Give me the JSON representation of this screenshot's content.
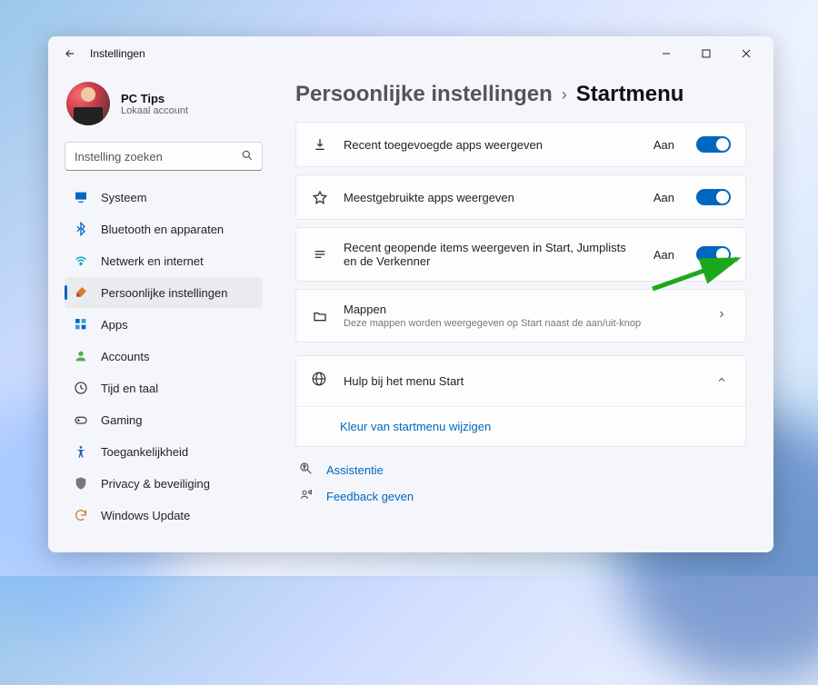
{
  "window": {
    "title": "Instellingen"
  },
  "profile": {
    "name": "PC Tips",
    "account_type": "Lokaal account"
  },
  "search": {
    "placeholder": "Instelling zoeken"
  },
  "sidebar": {
    "items": [
      {
        "icon": "monitor",
        "label": "Systeem",
        "color": "#0067c0"
      },
      {
        "icon": "bluetooth",
        "label": "Bluetooth en apparaten",
        "color": "#0067c0"
      },
      {
        "icon": "wifi",
        "label": "Netwerk en internet",
        "color": "#00a6b7"
      },
      {
        "icon": "brush",
        "label": "Persoonlijke instellingen",
        "color": "#b03a2e",
        "selected": true
      },
      {
        "icon": "apps",
        "label": "Apps",
        "color": "#0067c0"
      },
      {
        "icon": "user",
        "label": "Accounts",
        "color": "#5aa657"
      },
      {
        "icon": "clock",
        "label": "Tijd en taal",
        "color": "#444"
      },
      {
        "icon": "game",
        "label": "Gaming",
        "color": "#444"
      },
      {
        "icon": "access",
        "label": "Toegankelijkheid",
        "color": "#1a5fb4"
      },
      {
        "icon": "shield",
        "label": "Privacy & beveiliging",
        "color": "#777"
      },
      {
        "icon": "update",
        "label": "Windows Update",
        "color": "#c2862b"
      }
    ]
  },
  "breadcrumb": {
    "parent": "Persoonlijke instellingen",
    "current": "Startmenu"
  },
  "settings": [
    {
      "icon": "download",
      "title": "Recent toegevoegde apps weergeven",
      "status": "Aan"
    },
    {
      "icon": "star",
      "title": "Meestgebruikte apps weergeven",
      "status": "Aan"
    },
    {
      "icon": "list",
      "title": "Recent geopende items weergeven in Start, Jumplists en de Verkenner",
      "status": "Aan",
      "highlight": true
    },
    {
      "icon": "folder",
      "title": "Mappen",
      "sub": "Deze mappen worden weergegeven op Start naast de aan/uit-knop",
      "chevron": true
    }
  ],
  "help": {
    "title": "Hulp bij het menu Start",
    "link": "Kleur van startmenu wijzigen"
  },
  "footer": [
    {
      "icon": "assist",
      "label": "Assistentie"
    },
    {
      "icon": "feedback",
      "label": "Feedback geven"
    }
  ]
}
